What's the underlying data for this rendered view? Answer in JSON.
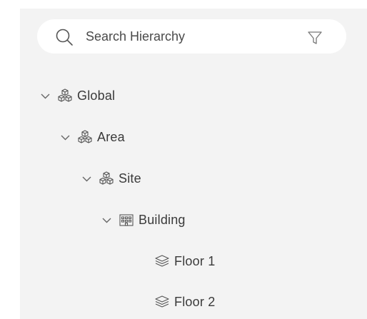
{
  "search": {
    "placeholder": "Search Hierarchy",
    "search_icon": "search-icon",
    "filter_icon": "filter-icon"
  },
  "tree": {
    "nodes": [
      {
        "label": "Global",
        "icon": "hierarchy-cubes-icon",
        "expanded": true
      },
      {
        "label": "Area",
        "icon": "hierarchy-cubes-icon",
        "expanded": true
      },
      {
        "label": "Site",
        "icon": "hierarchy-cubes-icon",
        "expanded": true
      },
      {
        "label": "Building",
        "icon": "building-icon",
        "expanded": true
      },
      {
        "label": "Floor 1",
        "icon": "floor-layers-icon"
      },
      {
        "label": "Floor 2",
        "icon": "floor-layers-icon"
      }
    ]
  },
  "colors": {
    "panel_background": "#f3f3f3",
    "search_background": "#ffffff",
    "text": "#3a3a3a",
    "icon_stroke": "#555555"
  }
}
